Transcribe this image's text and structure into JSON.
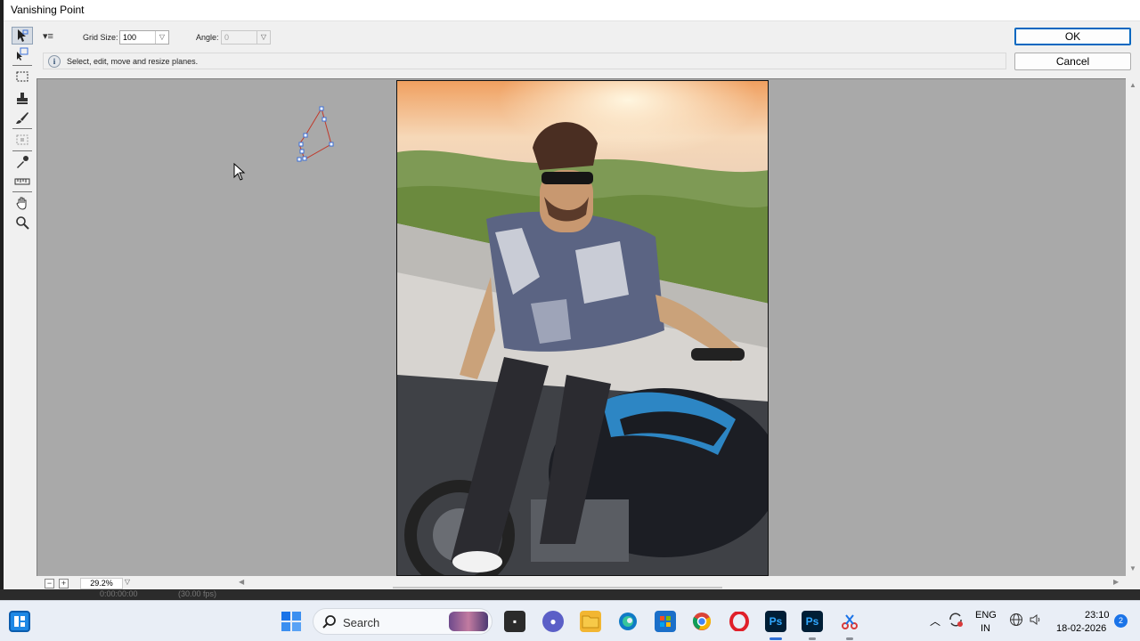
{
  "dialog": {
    "title": "Vanishing Point",
    "ok_label": "OK",
    "cancel_label": "Cancel"
  },
  "options": {
    "grid_size_label": "Grid Size:",
    "grid_size_value": "100",
    "angle_label": "Angle:",
    "angle_value": "0"
  },
  "info": {
    "message": "Select, edit, move and resize planes."
  },
  "tools": [
    {
      "icon": "edit-plane-tool-icon"
    },
    {
      "icon": "create-plane-tool-icon"
    },
    {
      "icon": "marquee-tool-icon"
    },
    {
      "icon": "stamp-tool-icon"
    },
    {
      "icon": "brush-tool-icon"
    },
    {
      "icon": "transform-tool-icon"
    },
    {
      "icon": "eyedropper-tool-icon"
    },
    {
      "icon": "measure-tool-icon"
    },
    {
      "icon": "hand-tool-icon"
    },
    {
      "icon": "zoom-tool-icon"
    }
  ],
  "status": {
    "zoom": "29.2%"
  },
  "background_player": {
    "timecode": "0:00:00:00",
    "fps": "(30.00 fps)"
  },
  "taskbar": {
    "search_placeholder": "Search",
    "language_top": "ENG",
    "language_bottom": "IN",
    "time": "23:10",
    "date": "18-02-2026",
    "notification_count": "2"
  },
  "colors": {
    "accent": "#0067c0",
    "canvas": "#a9a9a9",
    "plane_outline": "#c0392b",
    "plane_handle": "#3a6fd8"
  }
}
